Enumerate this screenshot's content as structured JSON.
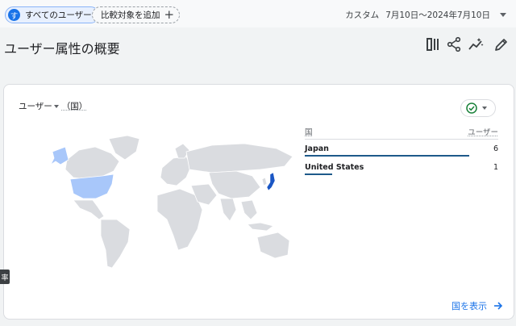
{
  "topbar": {
    "segment_avatar": "す",
    "segment_label": "すべてのユーザー",
    "add_compare_label": "比較対象を追加",
    "date_preset": "カスタム",
    "date_range": "7月10日～2024年7月10日"
  },
  "header": {
    "title": "ユーザー属性の概要"
  },
  "card": {
    "metric_label": "ユーザー",
    "dimension_label": "（国）",
    "table": {
      "col_dimension": "国",
      "col_metric": "ユーザー",
      "rows": [
        {
          "country": "Japan",
          "users": "6",
          "share": 1.0
        },
        {
          "country": "United States",
          "users": "1",
          "share": 0.167
        }
      ]
    },
    "view_link": "国を表示"
  },
  "side_tab": "率",
  "colors": {
    "accent": "#1a73e8",
    "map_land": "#dadce0",
    "map_low": "#a8c7fa",
    "map_high": "#1a56c4",
    "bar": "#1e5a8a"
  }
}
